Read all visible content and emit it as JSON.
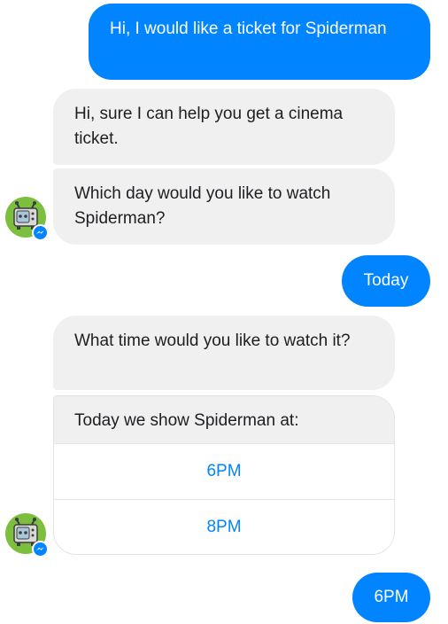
{
  "colors": {
    "outgoing_bubble": "#0084ff",
    "incoming_bubble": "#f1f0f0",
    "quick_reply_text": "#0084ff",
    "avatar_background": "#7cbf3f"
  },
  "icons": {
    "avatar": "robot-bot-avatar-icon",
    "badge": "messenger-badge-icon"
  },
  "messages": [
    {
      "from": "user",
      "text": "Hi, I would like a ticket for Spiderman"
    },
    {
      "from": "bot",
      "text": "Hi, sure I can help you get a cinema ticket."
    },
    {
      "from": "bot",
      "text": "Which day would you like to watch Spiderman?"
    },
    {
      "from": "user",
      "text": "Today"
    },
    {
      "from": "bot",
      "text": "What time would you like to watch it?"
    },
    {
      "from": "bot",
      "card": {
        "title": "Today we show Spiderman at:",
        "buttons": [
          "6PM",
          "8PM"
        ]
      }
    },
    {
      "from": "user",
      "text": "6PM"
    }
  ]
}
